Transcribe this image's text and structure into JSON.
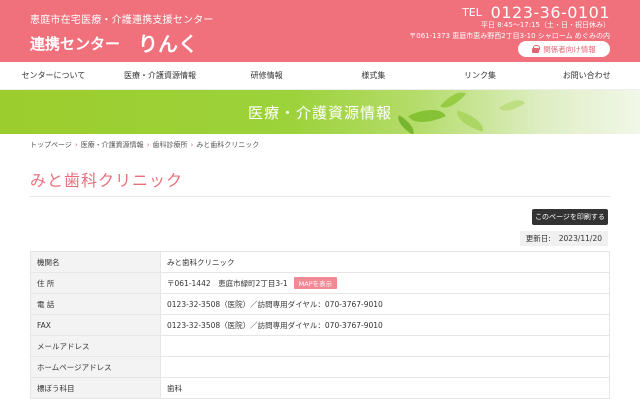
{
  "header": {
    "org_sub": "恵庭市在宅医療・介護連携支援センター",
    "logo_main": "連携センター",
    "logo_rinku": "りんく",
    "tel_label": "TEL",
    "tel_number": "0123-36-0101",
    "hours": "平日 8:45〜17:15（土・日・祝日休み）",
    "address": "〒061-1373 恵庭市恵み野西2丁目3-10 シャローム めぐみの内",
    "staff_button": "関係者向け情報"
  },
  "nav": {
    "items": [
      "センターについて",
      "医療・介護資源情報",
      "研修情報",
      "様式集",
      "リンク集",
      "お問い合わせ"
    ]
  },
  "hero": {
    "title": "医療・介護資源情報"
  },
  "breadcrumb": {
    "items": [
      "トップページ",
      "医療・介護資源情報",
      "歯科診療所",
      "みと歯科クリニック"
    ],
    "separator": "›"
  },
  "page": {
    "title": "みと歯科クリニック",
    "print_button": "このページを印刷する",
    "updated_label": "更新日:",
    "updated_date": "2023/11/20"
  },
  "table": {
    "rows": [
      {
        "label": "機関名",
        "value": "みと歯科クリニック"
      },
      {
        "label": "住 所",
        "value": "〒061-1442　恵庭市緑町2丁目3-1",
        "button": "MAPを表示"
      },
      {
        "label": "電 話",
        "value": "0123-32-3508（医院）／訪問専用ダイヤル：070-3767-9010"
      },
      {
        "label": "FAX",
        "value": "0123-32-3508（医院）／訪問専用ダイヤル：070-3767-9010"
      },
      {
        "label": "メールアドレス",
        "value": ""
      },
      {
        "label": "ホームページアドレス",
        "value": ""
      },
      {
        "label": "標ぼう科目",
        "value": "歯科"
      }
    ]
  },
  "colors": {
    "brand_pink": "#f0707c",
    "title_pink": "#e8707c",
    "hero_green": "#9ccd2e"
  },
  "icons": {
    "staff_button_icon": "lock-icon"
  }
}
